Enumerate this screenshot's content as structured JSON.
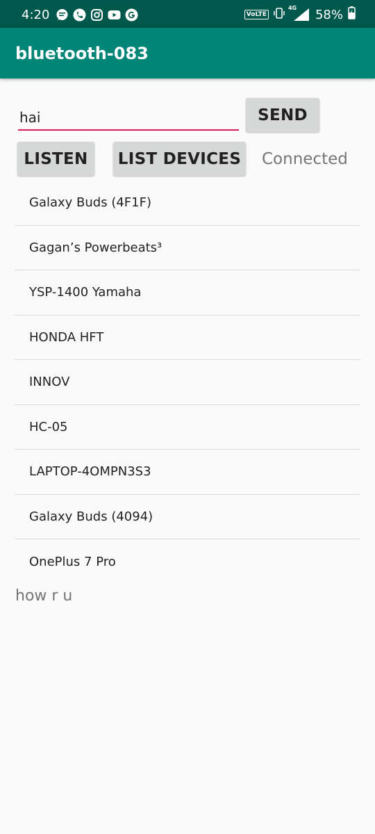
{
  "status_bar": {
    "time": "4:20",
    "network_badge": "VoLTE",
    "network_type": "4G",
    "battery": "58%",
    "notification_icons": [
      "messages-icon",
      "phone-icon",
      "instagram-icon",
      "youtube-icon",
      "google-icon"
    ]
  },
  "app_bar": {
    "title": "bluetooth-083"
  },
  "message": {
    "value": "hai"
  },
  "buttons": {
    "send": "SEND",
    "listen": "LISTEN",
    "list_devices": "LIST DEVICES"
  },
  "connection_status": "Connected",
  "devices": [
    "Galaxy Buds (4F1F)",
    "Gagan’s Powerbeats³",
    "YSP-1400 Yamaha",
    "HONDA HFT",
    "INNOV",
    "HC-05",
    "LAPTOP-4OMPN3S3",
    "Galaxy Buds (4094)",
    "OnePlus 7 Pro"
  ],
  "received_message": "how r u",
  "colors": {
    "status_bar": "#00574b",
    "app_bar": "#008577",
    "accent": "#d81b60",
    "button": "#d6d7d7"
  }
}
